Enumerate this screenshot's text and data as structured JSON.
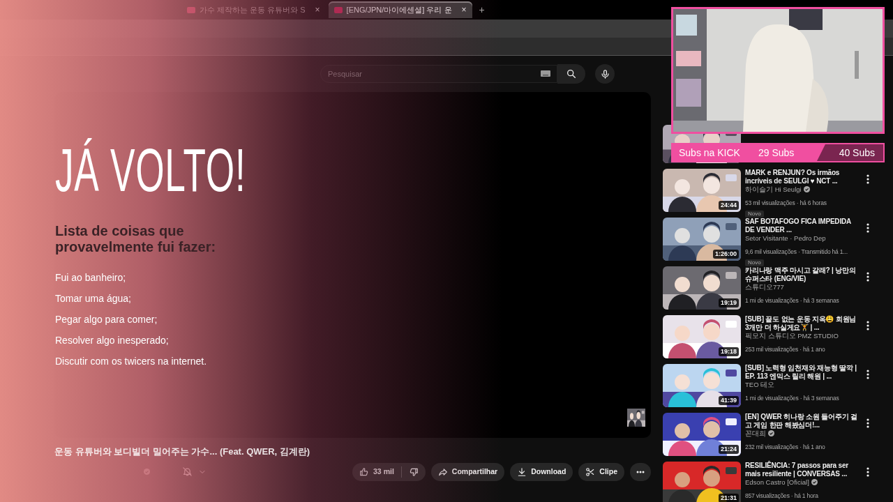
{
  "browser": {
    "tabs": [
      {
        "title": "가수 제작하는 운동 유튜버와 S",
        "close": "×",
        "selected": false
      },
      {
        "title": "[ENG/JPN/마이에센셜] 우리 운",
        "close": "×",
        "selected": true
      }
    ],
    "new_tab": "+"
  },
  "youtube": {
    "search": {
      "placeholder": "Pesquisar"
    },
    "video": {
      "title": "운동 유튜버와 보디빌더 밀어주는 가수... (Feat. QWER, 김계란)",
      "likes": "33 mil",
      "actions": [
        {
          "kind": "share",
          "label": "Compartilhar"
        },
        {
          "kind": "download",
          "label": "Download"
        },
        {
          "kind": "clip",
          "label": "Clipe"
        }
      ]
    },
    "recommendations": [
      {
        "title": "MARK e RENJUN? Os irmãos incríveis de SEULGI ♥ NCT ...",
        "channel": "하이슬기 Hi Seulgi",
        "verified": true,
        "meta": "53 mil visualizações · há 6 horas",
        "duration": "24:44",
        "badge": "Novo"
      },
      {
        "title": "SAF BOTAFOGO FICA IMPEDIDA DE VENDER ...",
        "channel": "Setor Visitante · Pedro Dep",
        "verified": false,
        "meta": "9,6 mil visualizações · Transmitido há 1...",
        "duration": "1:26:00",
        "badge": "Novo"
      },
      {
        "title": "카리나랑 맥주 마시고 갈래? | 낭만의 슈퍼스타 (ENG/VIE)",
        "channel": "스튜디오777",
        "verified": false,
        "meta": "1 mi de visualizações · há 3 semanas",
        "duration": "19:19"
      },
      {
        "title": "[SUB] 끝도 없는 운동 지옥😩 회원님 3개만 더 하실게요🏋 | ...",
        "channel": "픽모지 스튜디오 PMZ STUDIO",
        "verified": false,
        "meta": "253 mil visualizações · há 1 ano",
        "duration": "19:18"
      },
      {
        "title": "[SUB] 노력형 임천재와 재능형 딸깍 | EP. 113 엔믹스 릴리 해원 | ...",
        "channel": "TEO 테오",
        "verified": false,
        "meta": "1 mi de visualizações · há 3 semanas",
        "duration": "41:39"
      },
      {
        "title": "[EN] QWER 히나랑 소원 들어주기 걸고 게임 한판 해봤심더!...",
        "channel": "꼰대희",
        "verified": true,
        "meta": "232 mil visualizações · há 1 ano",
        "duration": "21:24"
      },
      {
        "title": "RESILIÊNCIA: 7 passos para ser mais resiliente | CONVERSAS ...",
        "channel": "Edson Castro [Oficial]",
        "verified": true,
        "meta": "857 visualizações · há 1 hora",
        "duration": "21:31"
      }
    ]
  },
  "overlay": {
    "heading": "JÁ VOLTO!",
    "subtitle": "Lista de coisas que provavelmente fui fazer:",
    "items": [
      "Fui ao banheiro;",
      "Tomar uma água;",
      "Pegar algo para comer;",
      "Resolver algo inesperado;",
      "Discutir com os twicers na internet."
    ],
    "subs": {
      "label": "Subs na KICK",
      "current": "29 Subs",
      "goal": "40 Subs",
      "level": 0.725
    }
  }
}
